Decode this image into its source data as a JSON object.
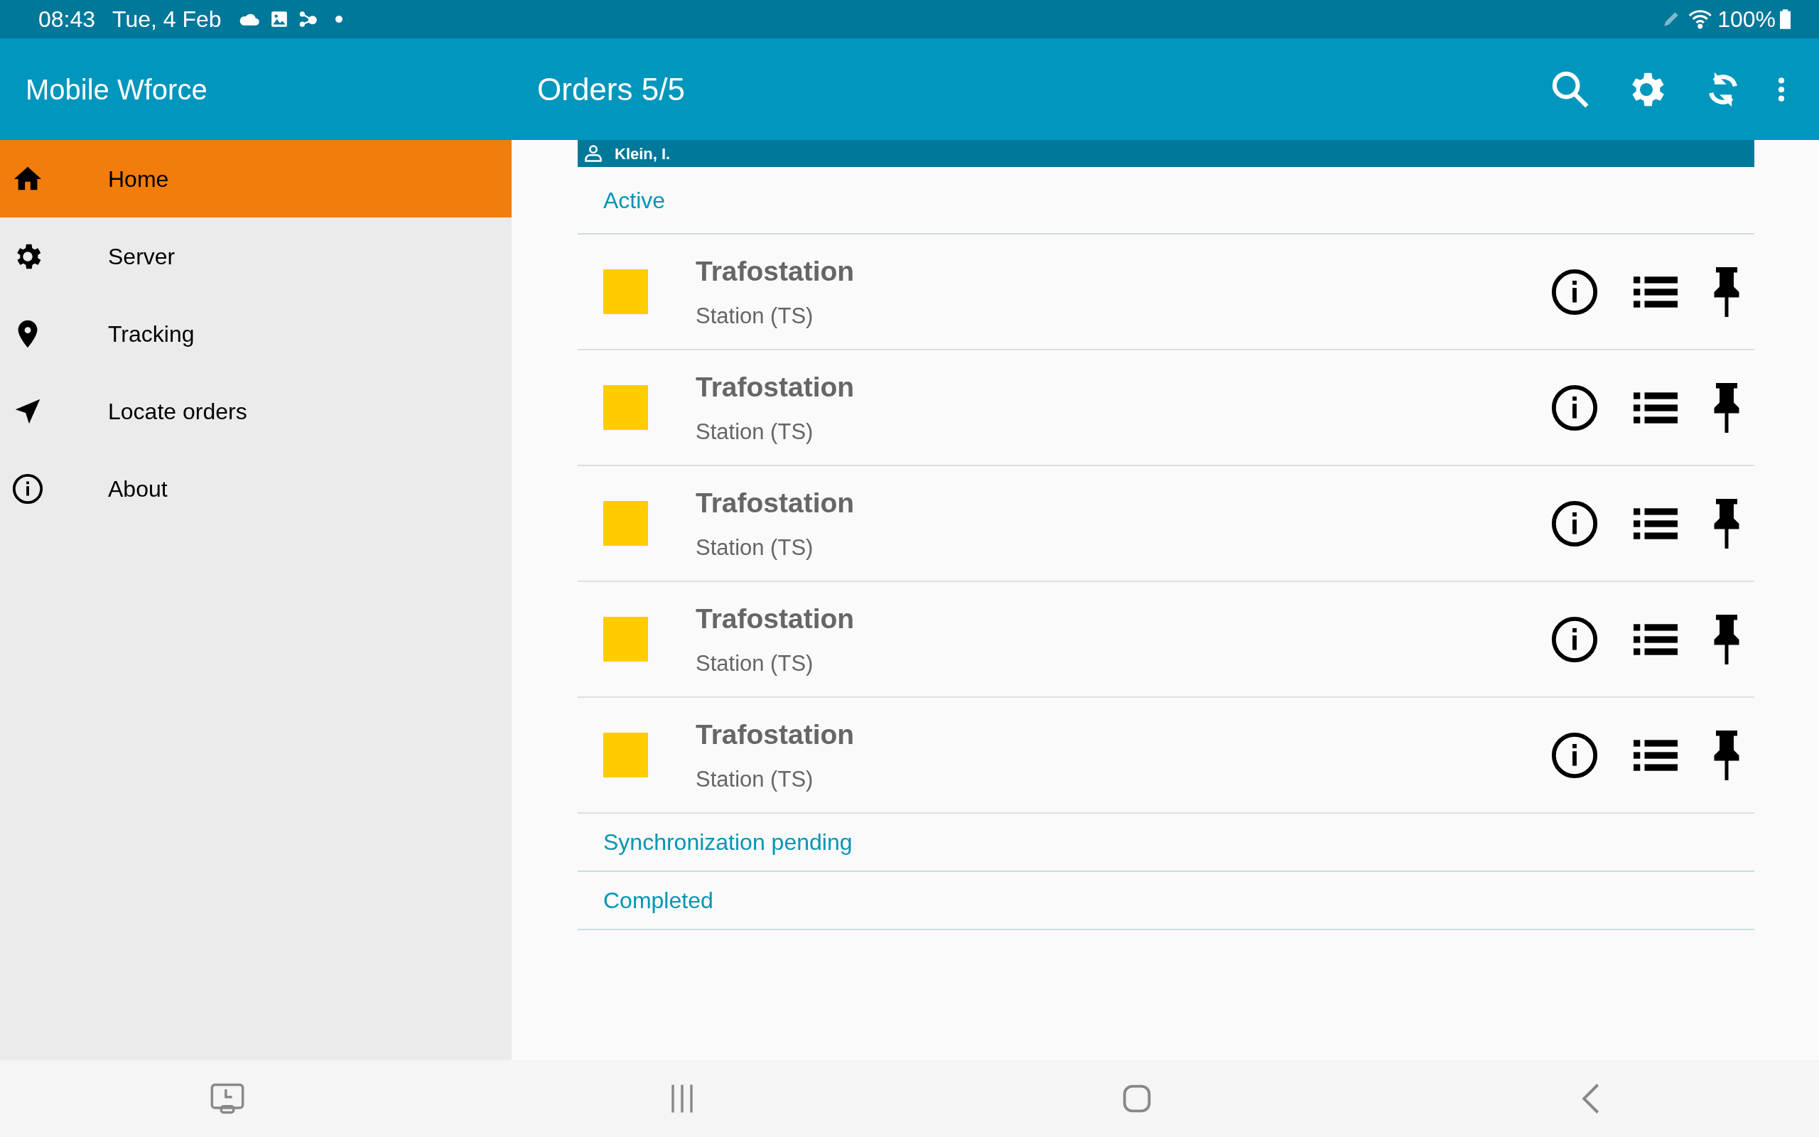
{
  "status_bar": {
    "time": "08:43",
    "date": "Tue, 4 Feb",
    "battery": "100%"
  },
  "drawer": {
    "title": "Mobile Wforce",
    "items": [
      {
        "label": "Home",
        "selected": true
      },
      {
        "label": "Server",
        "selected": false
      },
      {
        "label": "Tracking",
        "selected": false
      },
      {
        "label": "Locate orders",
        "selected": false
      },
      {
        "label": "About",
        "selected": false
      }
    ]
  },
  "app_bar": {
    "title": "Orders 5/5"
  },
  "user": {
    "name": "Klein, I."
  },
  "sections": [
    {
      "title": "Active",
      "orders": [
        {
          "title": "Trafostation",
          "subtitle": "Station (TS)",
          "color": "#ffcc00"
        },
        {
          "title": "Trafostation",
          "subtitle": "Station (TS)",
          "color": "#ffcc00"
        },
        {
          "title": "Trafostation",
          "subtitle": "Station (TS)",
          "color": "#ffcc00"
        },
        {
          "title": "Trafostation",
          "subtitle": "Station (TS)",
          "color": "#ffcc00"
        },
        {
          "title": "Trafostation",
          "subtitle": "Station (TS)",
          "color": "#ffcc00"
        }
      ]
    },
    {
      "title": "Synchronization pending"
    },
    {
      "title": "Completed"
    }
  ]
}
